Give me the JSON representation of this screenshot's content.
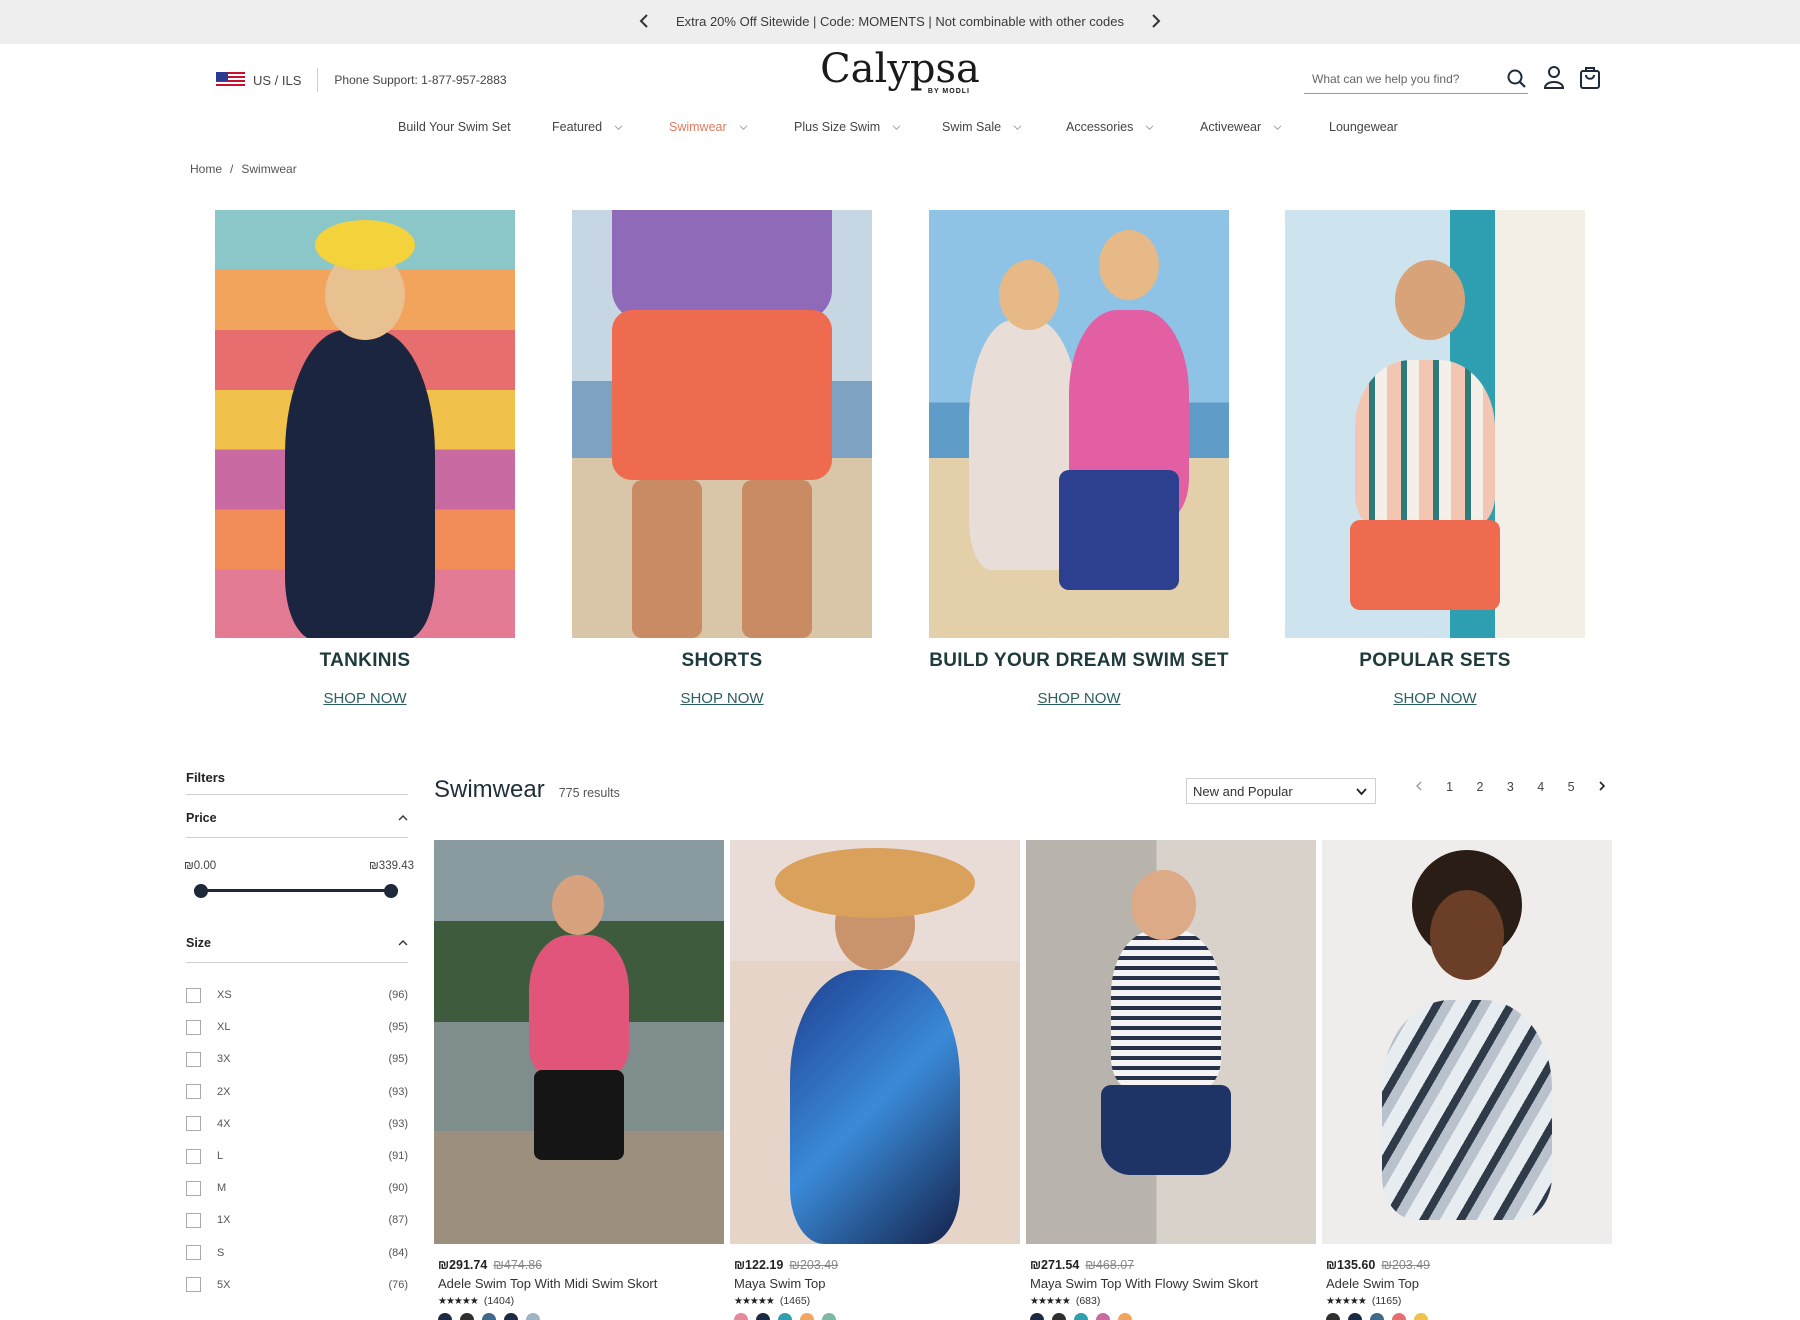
{
  "announcement": {
    "text": "Extra 20% Off Sitewide | Code: MOMENTS | Not combinable with other codes",
    "prev_icon": "chevron-left-icon",
    "next_icon": "chevron-right-icon"
  },
  "header": {
    "locale": "US / ILS",
    "phone": "Phone Support: 1-877-957-2883",
    "logo": "Calypsa",
    "logo_sub": "BY MODLI",
    "search_placeholder": "What can we help you find?"
  },
  "nav": [
    {
      "label": "Build Your Swim Set",
      "dropdown": false
    },
    {
      "label": "Featured",
      "dropdown": true
    },
    {
      "label": "Swimwear",
      "dropdown": true,
      "active": true
    },
    {
      "label": "Plus Size Swim",
      "dropdown": true
    },
    {
      "label": "Swim Sale",
      "dropdown": true
    },
    {
      "label": "Accessories",
      "dropdown": true
    },
    {
      "label": "Activewear",
      "dropdown": true
    },
    {
      "label": "Loungewear",
      "dropdown": false
    }
  ],
  "breadcrumb": {
    "home": "Home",
    "sep": "/",
    "current": "Swimwear"
  },
  "categories": [
    {
      "title": "TANKINIS",
      "cta": "SHOP NOW"
    },
    {
      "title": "SHORTS",
      "cta": "SHOP NOW"
    },
    {
      "title": "BUILD YOUR DREAM SWIM SET",
      "cta": "SHOP NOW"
    },
    {
      "title": "POPULAR SETS",
      "cta": "SHOP NOW"
    }
  ],
  "filters": {
    "title": "Filters",
    "price": {
      "label": "Price",
      "min": "₪0.00",
      "max": "₪339.43"
    },
    "size": {
      "label": "Size",
      "options": [
        {
          "label": "XS",
          "count": "(96)"
        },
        {
          "label": "XL",
          "count": "(95)"
        },
        {
          "label": "3X",
          "count": "(95)"
        },
        {
          "label": "2X",
          "count": "(93)"
        },
        {
          "label": "4X",
          "count": "(93)"
        },
        {
          "label": "L",
          "count": "(91)"
        },
        {
          "label": "M",
          "count": "(90)"
        },
        {
          "label": "1X",
          "count": "(87)"
        },
        {
          "label": "S",
          "count": "(84)"
        },
        {
          "label": "5X",
          "count": "(76)"
        }
      ]
    }
  },
  "results": {
    "heading": "Swimwear",
    "count": "775 results",
    "sort": "New and Popular",
    "pages": [
      "1",
      "2",
      "3",
      "4",
      "5"
    ]
  },
  "products": [
    {
      "price": "₪291.74",
      "was": "₪474.86",
      "name": "Adele Swim Top With Midi Swim Skort",
      "stars": "★★★★★",
      "reviews": "(1404)",
      "swatches": [
        "#1d2a44",
        "#2f2f2f",
        "#3f6a8a",
        "#1d2a44",
        "#9fb3c7"
      ]
    },
    {
      "price": "₪122.19",
      "was": "₪203.49",
      "name": "Maya Swim Top",
      "stars": "★★★★★",
      "reviews": "(1465)",
      "swatches": [
        "#e58a9a",
        "#1d2a44",
        "#2f9fb0",
        "#f2a35c",
        "#7fb8a4"
      ]
    },
    {
      "price": "₪271.54",
      "was": "₪468.07",
      "name": "Maya Swim Top With Flowy Swim Skort",
      "stars": "★★★★★",
      "reviews": "(683)",
      "swatches": [
        "#1d2a44",
        "#2f2f2f",
        "#2f9fb0",
        "#c96ba2",
        "#f2a35c"
      ]
    },
    {
      "price": "₪135.60",
      "was": "₪203.49",
      "name": "Adele Swim Top",
      "stars": "★★★★★",
      "reviews": "(1165)",
      "swatches": [
        "#2f2f2f",
        "#1d2a44",
        "#3f6a8a",
        "#e66e6e",
        "#f0c14b"
      ]
    }
  ],
  "colors": {
    "accent": "#e07a5f",
    "teal_text": "#2c5f5f",
    "dark": "#1e2a3a"
  }
}
